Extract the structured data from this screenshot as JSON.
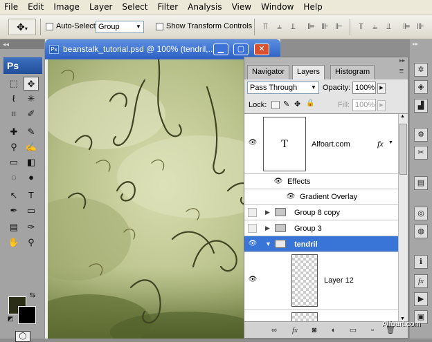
{
  "menubar": {
    "items": [
      "File",
      "Edit",
      "Image",
      "Layer",
      "Select",
      "Filter",
      "Analysis",
      "View",
      "Window",
      "Help"
    ]
  },
  "options": {
    "tool_icon": "move-tool-icon",
    "auto_select_label": "Auto-Select:",
    "auto_select_value": "Group",
    "transform_label": "Show Transform Controls"
  },
  "toolbox": {
    "app_logo": "Ps",
    "fg_color": "#2b2d16",
    "bg_color": "#000000"
  },
  "document": {
    "title": "beanstalk_tutorial.psd @ 100% (tendril,..."
  },
  "panel": {
    "tabs": [
      "Navigator",
      "Layers",
      "Histogram"
    ],
    "blend_mode": "Pass Through",
    "opacity_label": "Opacity:",
    "opacity_value": "100%",
    "lock_label": "Lock:",
    "fill_label": "Fill:",
    "fill_value": "100%",
    "layers": {
      "text_layer": {
        "name": "Alfoart.com",
        "thumb": "T",
        "fx": "fx"
      },
      "effects_label": "Effects",
      "effect_item": "Gradient Overlay",
      "group8": "Group 8 copy",
      "group3": "Group 3",
      "tendril": "tendril",
      "layer12": "Layer 12"
    }
  },
  "watermark": "Alfoart.com",
  "colors": {
    "selection_blue": "#3875d7",
    "title_blue": "#2b5fc4"
  }
}
